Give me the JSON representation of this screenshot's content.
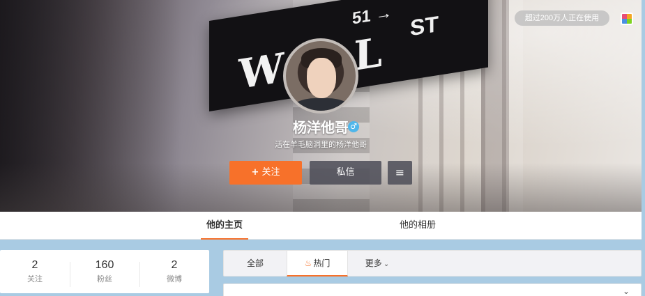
{
  "cover": {
    "sign_word": "WALL",
    "sign_number": "51 →",
    "sign_street": "ST"
  },
  "header": {
    "users_pill": "超过200万人正在使用",
    "palette_icon": "palette-icon"
  },
  "profile": {
    "name": "杨洋他哥",
    "gender_icon": "♂",
    "bio": "活在羊毛脑洞里的杨洋他哥"
  },
  "actions": {
    "follow_plus": "+",
    "follow_label": "关注",
    "message_label": "私信",
    "more_icon": "≡"
  },
  "tabs": [
    {
      "label": "他的主页",
      "active": true
    },
    {
      "label": "他的相册",
      "active": false
    }
  ],
  "stats": [
    {
      "value": "2",
      "label": "关注"
    },
    {
      "value": "160",
      "label": "粉丝"
    },
    {
      "value": "2",
      "label": "微博"
    }
  ],
  "feed_filter": {
    "all": "全部",
    "hot_icon": "♨",
    "hot": "热门",
    "more": "更多",
    "more_chevron": "⌄"
  },
  "feed_card": {
    "collapse_icon": "⌄"
  },
  "colors": {
    "accent": "#f7712a",
    "button_dark": "#50505a",
    "page_bg": "#a9cbe3"
  }
}
